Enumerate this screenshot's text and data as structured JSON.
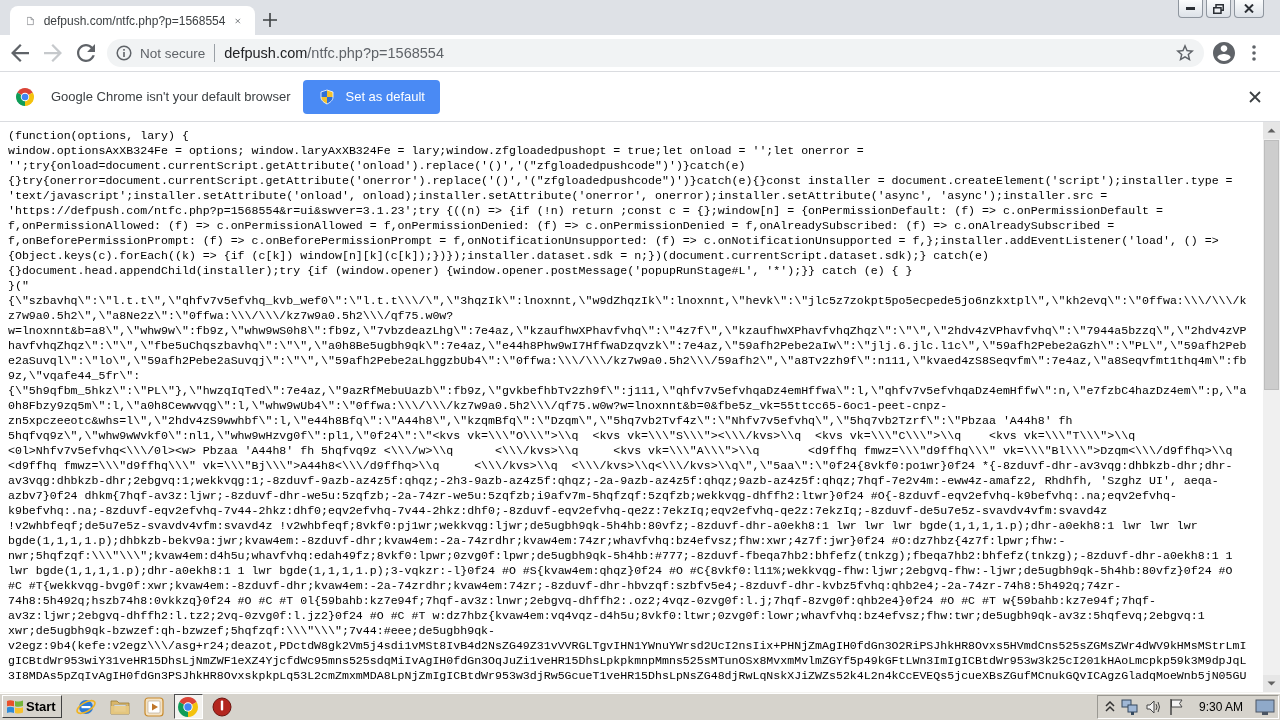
{
  "tabs": [
    {
      "title": "defpush.com/ntfc.php?p=1568554",
      "selected": true
    }
  ],
  "nav_buttons": [
    {
      "kind": "back",
      "disabled": false
    },
    {
      "kind": "forward",
      "disabled": true
    },
    {
      "kind": "reload",
      "disabled": false
    }
  ],
  "address_bar": {
    "security_label": "Not secure",
    "url_host": "defpush.com",
    "url_path": "/ntfc.php?p=1568554",
    "bookmarked": false
  },
  "infobar": {
    "message": "Google Chrome isn't your default browser",
    "button": "Set as default"
  },
  "page": {
    "lines": [
      "(function(options, lary) {",
      "window.optionsAxXB324Fe = options; window.laryAxXB324Fe = lary;window.zfgloadedpushopt = true;let onload = '';let onerror =",
      "'';try{onload=document.currentScript.getAttribute('onload').replace('()','(\"zfgloadedpushcode\")')}catch(e)",
      "{}try{onerror=document.currentScript.getAttribute('onerror').replace('()','(\"zfgloadedpushcode\")')}catch(e){}const installer = document.createElement('script');installer.type =",
      "'text/javascript';installer.setAttribute('onload', onload);installer.setAttribute('onerror', onerror);installer.setAttribute('async', 'async');installer.src =",
      "'https://defpush.com/ntfc.php?p=1568554&r=ui&swver=3.1.23';try {((n) => {if (!n) return ;const c = {};window[n] = {onPermissionDefault: (f) => c.onPermissionDefault =",
      "f,onPermissionAllowed: (f) => c.onPermissionAllowed = f,onPermissionDenied: (f) => c.onPermissionDenied = f,onAlreadySubscribed: (f) => c.onAlreadySubscribed =",
      "f,onBeforePermissionPrompt: (f) => c.onBeforePermissionPrompt = f,onNotificationUnsupported: (f) => c.onNotificationUnsupported = f,};installer.addEventListener('load', () =>",
      "{Object.keys(c).forEach((k) => {if (c[k]) window[n][k](c[k]);})});installer.dataset.sdk = n;})(document.currentScript.dataset.sdk);} catch(e)",
      "{}document.head.appendChild(installer);try {if (window.opener) {window.opener.postMessage('popupRunStage#L', '*');}} catch (e) { }",
      "}(\"",
      "{\\\"szbavhq\\\":\\\"l.t.t\\\",\\\"qhfv7v5efvhq_kvb_wef0\\\":\\\"l.t.t\\\\\\/\\\",\\\"3hqzIk\\\":lnoxnnt,\\\"w9dZhqzIk\\\":lnoxnnt,\\\"hevk\\\":\\\"jlc5z7zokpt5po5ecpede5jo6nzkxtpl\\\",\\\"kh2evq\\\":\\\"0ffwa:\\\\\\/\\\\\\/k",
      "z7w9a0.5h2\\\",\\\"a8Ne2z\\\":\\\"0ffwa:\\\\\\/\\\\\\/kz7w9a0.5h2\\\\\\/qf75.w0w?",
      "w=lnoxnnt&b=a8\\\",\\\"whw9w\\\":fb9z,\\\"whw9wS0h8\\\":fb9z,\\\"7vbzdeazLhg\\\":7e4az,\\\"kzaufhwXPhavfvhq\\\":\\\"4z7f\\\",\\\"kzaufhwXPhavfvhqZhqz\\\":\\\"\\\",\\\"2hdv4zVPhavfvhq\\\":\\\"7944a5bzzq\\\",\\\"2hdv4zVP",
      "havfvhqZhqz\\\":\\\"\\\",\\\"fbe5uChqszbavhq\\\":\\\"\\\",\\\"a0h8Be5ugbh9qk\\\":7e4az,\\\"e44h8Phw9wI7HffwaDzqvzk\\\":7e4az,\\\"59afh2Pebe2aIw\\\":\\\"jlj.6.jlc.l1c\\\",\\\"59afh2Pebe2aGzh\\\":\\\"PL\\\",\\\"59afh2Peb",
      "e2aSuvql\\\":\\\"lo\\\",\\\"59afh2Pebe2aSuvqj\\\":\\\"\\\",\\\"59afh2Pebe2aLhggzbUb4\\\":\\\"0ffwa:\\\\\\/\\\\\\/kz7w9a0.5h2\\\\\\/59afh2\\\",\\\"a8Tv2zh9f\\\":n111,\\\"kvaed4zS8Seqvfm\\\":7e4az,\\\"a8Seqvfmt1thq4m\\\":fb",
      "9z,\\\"vqafe44_5fr\\\":",
      "{\\\"5h9qfbm_5hkz\\\":\\\"PL\\\"},\\\"hwzqIqTed\\\":7e4az,\\\"9azRfMebuUazb\\\":fb9z,\\\"gvkbefhbTv2zh9f\\\":j111,\\\"qhfv7v5efvhqaDz4emHffwa\\\":l,\\\"qhfv7v5efvhqaDz4emHffw\\\":n,\\\"e7fzbC4hazDz4em\\\":p,\\\"a",
      "0h8Fbzy9zq5m\\\":l,\\\"a0h8Cewwvqg\\\":l,\\\"whw9wUb4\\\":\\\"0ffwa:\\\\\\/\\\\\\/kz7w9a0.5h2\\\\\\/qf75.w0w?w=lnoxnnt&b=0&fbe5z_vk=55ttcc65-6oc1-peet-cnpz-",
      "zn5xpczeeotc&whs=l\\\",\\\"2hdv4zS9wwhbf\\\":l,\\\"e44h8Bfq\\\":\\\"A44h8\\\",\\\"kzqmBfq\\\":\\\"Dzqm\\\",\\\"5hq7vb2Tvf4z\\\":\\\"Nhfv7v5efvhq\\\",\\\"5hq7vb2Tzrf\\\":\\\"Pbzaa 'A44h8' fh",
      "5hqfvq9z\\\",\\\"whw9wWvkf0\\\":nl1,\\\"whw9wHzvg0f\\\":pl1,\\\"0f24\\\":\\\"<kvs vk=\\\\\\\"O\\\\\\\">\\\\q  <kvs vk=\\\\\\\"S\\\\\\\"><\\\\\\/kvs>\\\\q  <kvs vk=\\\\\\\"C\\\\\\\">\\\\q    <kvs vk=\\\\\\\"T\\\\\\\">\\\\q",
      "<0l>Nhfv7v5efvhq<\\\\\\/0l><w> Pbzaa 'A44h8' fh 5hqfvq9z <\\\\\\/w>\\\\q      <\\\\\\/kvs>\\\\q     <kvs vk=\\\\\\\"A\\\\\\\">\\\\q       <d9ffhq fmwz=\\\\\\\"d9ffhq\\\\\\\" vk=\\\\\\\"Bl\\\\\\\">Dzqm<\\\\\\/d9ffhq>\\\\q",
      "<d9ffhq fmwz=\\\\\\\"d9ffhq\\\\\\\" vk=\\\\\\\"Bj\\\\\\\">A44h8<\\\\\\/d9ffhq>\\\\q     <\\\\\\/kvs>\\\\q  <\\\\\\/kvs>\\\\q<\\\\\\/kvs>\\\\q\\\",\\\"5aa\\\":\\\"0f24{8vkf0:po1wr}0f24 *{-8zduvf-dhr-av3vqg:dhbkzb-dhr;dhr-",
      "av3vqg:dhbkzb-dhr;2ebgvq:1;wekkvqg:1;-8zduvf-9azb-az4z5f:qhqz;-2h3-9azb-az4z5f:qhqz;-2a-9azb-az4z5f:qhqz;9azb-az4z5f:qhqz;7hqf-7e2v4m:-eww4z-amafz2, Rhdhfh, 'Szghz UI', aeqa-",
      "azbv7}0f24 dhkm{7hqf-av3z:ljwr;-8zduvf-dhr-we5u:5zqfzb;-2a-74zr-we5u:5zqfzb;i9afv7m-5hqfzqf:5zqfzb;wekkvqg-dhffh2:ltwr}0f24 #O{-8zduvf-eqv2efvhq-k9befvhq:.na;eqv2efvhq-",
      "k9befvhq:.na;-8zduvf-eqv2efvhq-7v44-2hkz:dhf0;eqv2efvhq-7v44-2hkz:dhf0;-8zduvf-eqv2efvhq-qe2z:7ekzIq;eqv2efvhq-qe2z:7ekzIq;-8zduvf-de5u7e5z-svavdv4vfm:svavd4z",
      "!v2whbfeqf;de5u7e5z-svavdv4vfm:svavd4z !v2whbfeqf;8vkf0:pj1wr;wekkvqg:ljwr;de5ugbh9qk-5h4hb:80vfz;-8zduvf-dhr-a0ekh8:1 lwr lwr lwr bgde(1,1,1,1.p);dhr-a0ekh8:1 lwr lwr lwr",
      "bgde(1,1,1,1.p);dhbkzb-bekv9a:jwr;kvaw4em:-8zduvf-dhr;kvaw4em:-2a-74zrdhr;kvaw4em:74zr;whavfvhq:bz4efvsz;fhw:xwr;4z7f:jwr}0f24 #O:dz7hbz{4z7f:lpwr;fhw:-",
      "nwr;5hqfzqf:\\\\\\\"\\\\\\\";kvaw4em:d4h5u;whavfvhq:edah49fz;8vkf0:lpwr;0zvg0f:lpwr;de5ugbh9qk-5h4hb:#777;-8zduvf-fbeqa7hb2:bhfefz(tnkzg);fbeqa7hb2:bhfefz(tnkzg);-8zduvf-dhr-a0ekh8:1 1",
      "lwr bgde(1,1,1,1.p);dhr-a0ekh8:1 1 lwr bgde(1,1,1,1.p);3-vqkzr:-l}0f24 #O #S{kvaw4em:qhqz}0f24 #O #C{8vkf0:l11%;wekkvqg-fhw:ljwr;2ebgvq-fhw:-ljwr;de5ugbh9qk-5h4hb:80vfz}0f24 #O",
      "#C #T{wekkvqg-bvg0f:xwr;kvaw4em:-8zduvf-dhr;kvaw4em:-2a-74zrdhr;kvaw4em:74zr;-8zduvf-dhr-hbvzqf:szbfv5e4;-8zduvf-dhr-kvbz5fvhq:qhb2e4;-2a-74zr-74h8:5h492q;74zr-",
      "74h8:5h492q;hszb74h8:0vkkzq}0f24 #O #C #T 0l{59bahb:kz7e94f;7hqf-av3z:lnwr;2ebgvq-dhffh2:.oz2;4vqz-0zvg0f:l.j;7hqf-8zvg0f:qhb2e4}0f24 #O #C #T w{59bahb:kz7e94f;7hqf-",
      "av3z:ljwr;2ebgvq-dhffh2:l.tz2;2vq-0zvg0f:l.jz2}0f24 #O #C #T w:dz7hbz{kvaw4em:vq4vqz-d4h5u;8vkf0:ltwr;0zvg0f:lowr;whavfvhq:bz4efvsz;fhw:twr;de5ugbh9qk-av3z:5hqfevq;2ebgvq:1",
      "xwr;de5ugbh9qk-bzwzef:qh-bzwzef;5hqfzqf:\\\\\\\"\\\\\\\";7v44:#eee;de5ugbh9qk-",
      "v2egz:9b4(kefe:v2egz\\\\\\/asg+r24;deazot,PDctdW8gk2Vm5j4sdi1vMSt8IvB4d2NsZG49Z31vVVRGLTgvIHN1YWnuYWrsd2UcI2nsIix+PHNjZmAgIH0fdGn3O2RiPSJhkHR8Ovxs5HVmdCns525sZGMsZWr4dWV9kHMsMStrLmI",
      "gICBtdWr953wiY31veHR15DhsLjNmZWF1eXZ4YjcfdWc95mns525sdqMiIvAgIH0fdGn3OqJuZi1veHR15DhsLpkpkmnpMmns525sMTunOSx8MvxmMvlmZGYf5p49kGFtLWn3ImIgICBtdWr953w3k25cI201kHAoLmcpkp59k3M9dpJqL",
      "3I8MDAs5pZqIvAgIH0fdGn3PSJhkHR8OvxskpkpLq53L2cmZmxmMDA8LpNjZmIgICBtdWr953w3djRw5GcueT1veHR15DhsLpNsZG48djRwLqNskXJiZWZs52k4L2n4kCcEVEQs5jcueXBsZGufMCnukGQvICAgzGladqMoeWnb5jN05GU"
    ]
  },
  "taskbar": {
    "start": "Start",
    "apps": [
      {
        "kind": "browser",
        "selected": false
      },
      {
        "kind": "folder",
        "selected": false
      },
      {
        "kind": "media",
        "selected": false
      },
      {
        "kind": "chrome",
        "selected": true
      },
      {
        "kind": "power",
        "selected": false
      }
    ],
    "clock": "9:30 AM"
  }
}
